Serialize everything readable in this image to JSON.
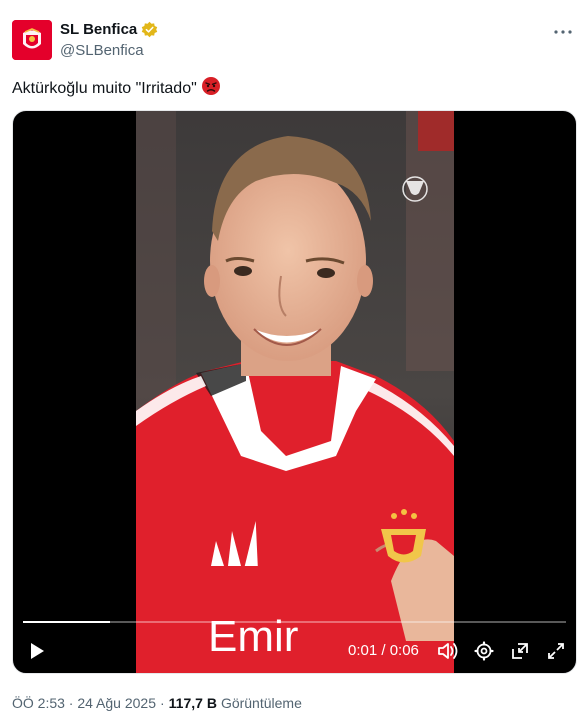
{
  "author": {
    "display_name": "SL Benfica",
    "handle": "@SLBenfica",
    "verified_badge": "gold-verified-icon"
  },
  "post": {
    "text": "Aktürkoğlu muito \"Irritado\"",
    "emoji": "angry-face-emoji"
  },
  "video": {
    "time_display": "0:01 / 0:06",
    "progress": 0.16,
    "overlay_text": "Emir"
  },
  "meta": {
    "timestamp": "ÖÖ 2:53 · 24 Ağu 2025",
    "separator": "·",
    "views_count": "117,7 B",
    "views_label": "Görüntüleme"
  },
  "colors": {
    "brand_red": "#e4002b",
    "jersey_red": "#e0202c",
    "verified_gold": "#e2b719",
    "text_primary": "#0f1419",
    "text_secondary": "#536471"
  }
}
